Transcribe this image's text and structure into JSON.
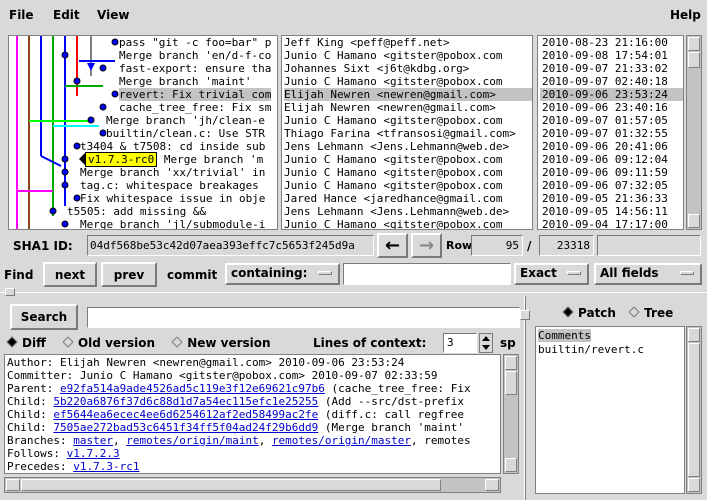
{
  "menu": {
    "file": "File",
    "edit": "Edit",
    "view": "View",
    "help": "Help"
  },
  "commits": [
    {
      "subject": "pass \"git -c foo=bar\" p",
      "author": "Jeff King <peff@peff.net>",
      "date": "2010-08-23 21:16:00"
    },
    {
      "subject": "Merge branch 'en/d-f-co",
      "author": "Junio C Hamano <gitster@pobox.com",
      "date": "2010-09-08 17:54:01"
    },
    {
      "subject": "fast-export: ensure tha",
      "author": "Johannes Sixt <j6t@kdbg.org>",
      "date": "2010-09-07 21:33:02"
    },
    {
      "subject": "Merge branch 'maint'",
      "author": "Junio C Hamano <gitster@pobox.com",
      "date": "2010-09-07 02:40:18"
    },
    {
      "subject": "revert: Fix trivial com",
      "author": "Elijah Newren <newren@gmail.com>",
      "date": "2010-09-06 23:53:24",
      "selected": true
    },
    {
      "subject": "cache_tree_free: Fix sm",
      "author": "Elijah Newren <newren@gmail.com>",
      "date": "2010-09-06 23:40:16"
    },
    {
      "subject": "Merge branch 'jh/clean-e",
      "author": "Junio C Hamano <gitster@pobox.com",
      "date": "2010-09-07 01:57:05"
    },
    {
      "subject": "builtin/clean.c: Use STR",
      "author": "Thiago Farina <tfransosi@gmail.com>",
      "date": "2010-09-07 01:32:55"
    },
    {
      "subject": "t3404 & t7508: cd inside sub",
      "author": "Jens Lehmann <Jens.Lehmann@web.de>",
      "date": "2010-09-06 20:41:06"
    },
    {
      "subject": "Merge branch 'm",
      "author": "Junio C Hamano <gitster@pobox.com",
      "date": "2010-09-06 09:12:04",
      "tag": "v1.7.3-rc0"
    },
    {
      "subject": "Merge branch 'xx/trivial' in",
      "author": "Junio C Hamano <gitster@pobox.com",
      "date": "2010-09-06 09:11:59"
    },
    {
      "subject": "tag.c: whitespace breakages",
      "author": "Junio C Hamano <gitster@pobox.com",
      "date": "2010-09-06 07:32:05"
    },
    {
      "subject": "Fix whitespace issue in obje",
      "author": "Jared Hance <jaredhance@gmail.com",
      "date": "2010-09-05 21:36:33"
    },
    {
      "subject": "t5505: add missing &&",
      "author": "Jens Lehmann <Jens.Lehmann@web.de>",
      "date": "2010-09-05 14:56:11"
    },
    {
      "subject": "Merge branch 'jl/submodule-i",
      "author": "Junio C Hamano <gitster@pobox.com",
      "date": "2010-09-04 17:17:00"
    }
  ],
  "sha": {
    "label": "SHA1 ID:",
    "value": "04df568be53c42d07aea393effc7c5653f245d9a"
  },
  "row": {
    "label": "Row",
    "current": "95",
    "separator": "/",
    "total": "23318"
  },
  "find": {
    "label": "Find",
    "next": "next",
    "prev": "prev",
    "commit": "commit",
    "containing": "containing:",
    "exact": "Exact",
    "fields": "All fields"
  },
  "search": {
    "button": "Search"
  },
  "diffopts": {
    "diff": "Diff",
    "old": "Old version",
    "new": "New version",
    "context_label": "Lines of context:",
    "context_value": "3",
    "sp": "sp"
  },
  "patchtree": {
    "patch": "Patch",
    "tree": "Tree"
  },
  "files": [
    "Comments",
    "builtin/revert.c"
  ],
  "details": {
    "author": "Author: Elijah Newren <newren@gmail.com>  2010-09-06 23:53:24",
    "committer": "Committer: Junio C Hamano <gitster@pobox.com>  2010-09-07 02:33:59",
    "parent_label": "Parent:",
    "parent_hash": "e92fa514a9ade4526ad5c119e3f12e69621c97b6",
    "parent_desc": "(cache_tree_free: Fix",
    "child1_label": "Child:",
    "child1_hash": "5b220a6876f37d6c88d1d7a54ec115efc1e25255",
    "child1_desc": "(Add --src/dst-prefix",
    "child2_label": "Child:",
    "child2_hash": "ef5644ea6ecec4ee6d6254612af2ed58499ac2fe",
    "child2_desc": "(diff.c: call regfree",
    "child3_label": "Child:",
    "child3_hash": "7505ae272bad53c6451f34ff5f04ad24f29b6dd9",
    "child3_desc": "(Merge branch 'maint'",
    "branches_label": "Branches:",
    "branch1": "master",
    "branch2": "remotes/origin/maint",
    "branch3": "remotes/origin/master",
    "branch_more": "remotes",
    "follows_label": "Follows:",
    "follows": "v1.7.2.3",
    "precedes_label": "Precedes:",
    "precedes": "v1.7.3-rc1"
  }
}
